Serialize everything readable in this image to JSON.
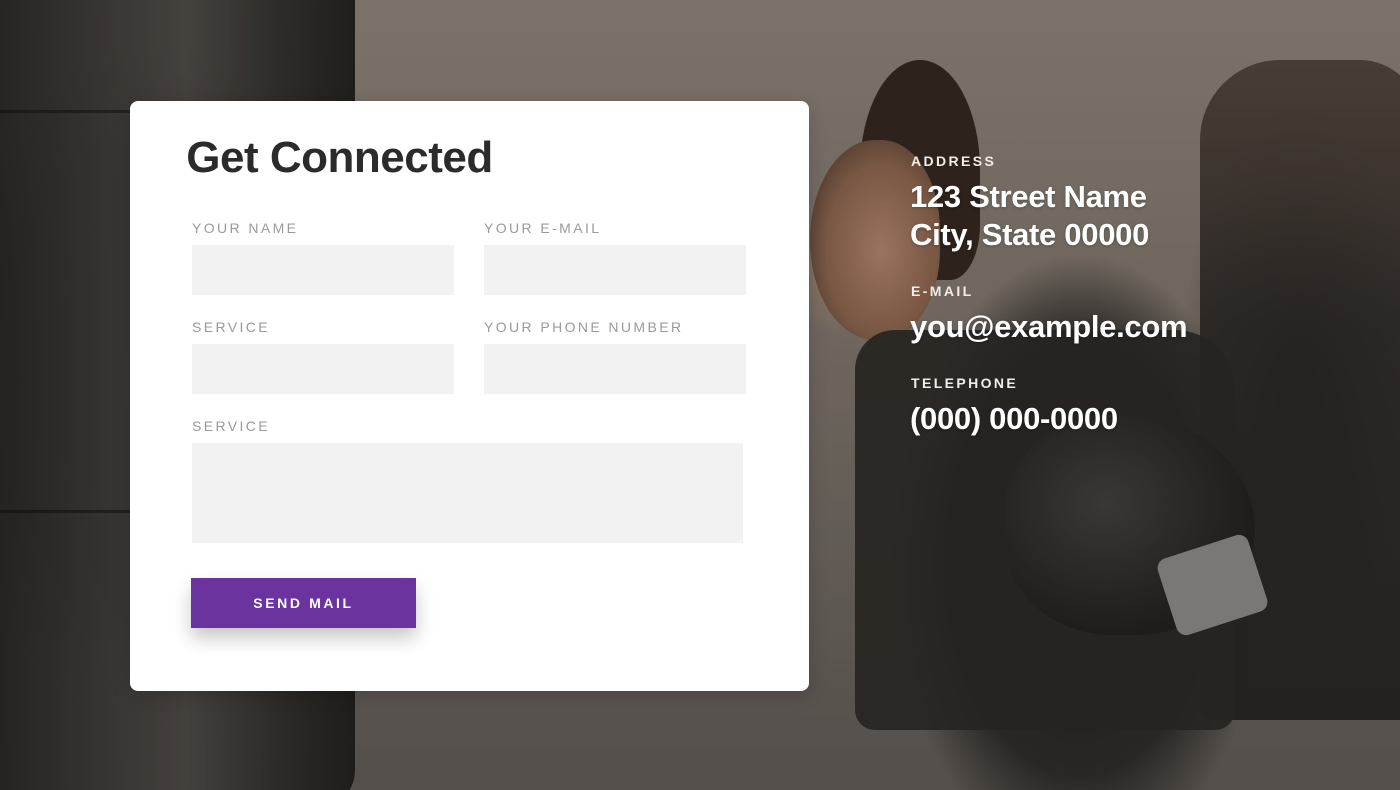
{
  "form": {
    "title": "Get Connected",
    "fields": [
      {
        "label": "YOUR NAME",
        "value": "",
        "placeholder": ""
      },
      {
        "label": "YOUR E-MAIL",
        "value": "",
        "placeholder": ""
      },
      {
        "label": "SERVICE",
        "value": "",
        "placeholder": ""
      },
      {
        "label": "YOUR PHONE NUMBER",
        "value": "",
        "placeholder": ""
      },
      {
        "label": "SERVICE",
        "value": "",
        "placeholder": ""
      }
    ],
    "submit_label": "SEND MAIL",
    "accent_color": "#6a339e"
  },
  "contact": {
    "address_label": "ADDRESS",
    "address_line1": "123 Street Name",
    "address_line2": "City, State 00000",
    "email_label": "E-MAIL",
    "email_value": "you@example.com",
    "telephone_label": "TELEPHONE",
    "telephone_value": "(000) 000-0000"
  },
  "background": {
    "icon": "boxing-gym-photo"
  }
}
